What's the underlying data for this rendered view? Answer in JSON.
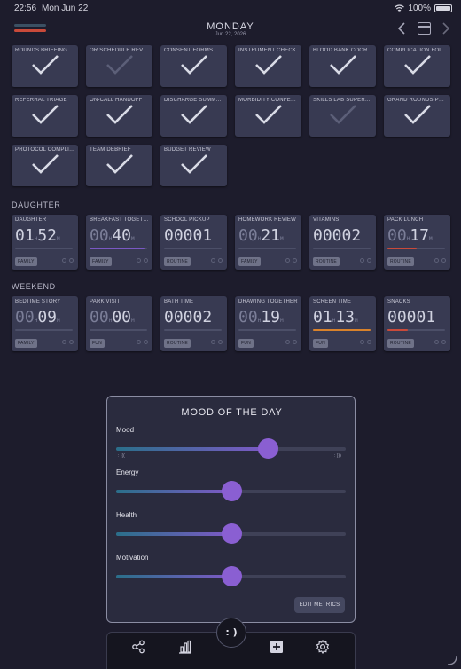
{
  "status": {
    "time": "22:56",
    "date": "Mon Jun 22",
    "battery": "100%"
  },
  "header": {
    "day": "MONDAY",
    "date": "Jun 22, 2026",
    "legend_colors": [
      "#3b5063",
      "#c94a3a"
    ]
  },
  "checklist": [
    {
      "label": "ROUNDS BRIEFING",
      "done": true
    },
    {
      "label": "OR SCHEDULE REVIEW",
      "done": false
    },
    {
      "label": "CONSENT FORMS",
      "done": true
    },
    {
      "label": "INSTRUMENT CHECK",
      "done": true
    },
    {
      "label": "BLOOD BANK COORDINATION",
      "done": true
    },
    {
      "label": "COMPLICATION FOLLOW-UP",
      "done": true
    },
    {
      "label": "REFERRAL TRIAGE",
      "done": true
    },
    {
      "label": "ON-CALL HANDOFF",
      "done": true
    },
    {
      "label": "DISCHARGE SUMMARIES",
      "done": true
    },
    {
      "label": "MORBIDITY CONFERENCE",
      "done": true
    },
    {
      "label": "SKILLS LAB SUPERVISION",
      "done": false
    },
    {
      "label": "GRAND ROUNDS PREP",
      "done": true
    },
    {
      "label": "PROTOCOL COMPLIANCE",
      "done": true
    },
    {
      "label": "TEAM DEBRIEF",
      "done": true
    },
    {
      "label": "BUDGET REVIEW",
      "done": true
    }
  ],
  "sections": {
    "daughter": "DAUGHTER",
    "weekend": "WEEKEND"
  },
  "daughter_tiles": [
    {
      "label": "DAUGHTER",
      "hours": "01",
      "minutes": "52",
      "badge": "FAMILY",
      "progress": 0.0,
      "bar_color": "#7a58c4"
    },
    {
      "label": "BREAKFAST TOGETHER",
      "hours": "00",
      "minutes": "40",
      "badge": "FAMILY",
      "progress": 0.95,
      "bar_color": "#7a58c4"
    },
    {
      "label": "SCHOOL PICKUP",
      "count": "00001",
      "badge": "ROUTINE",
      "progress": 0.0,
      "bar_color": "#7a58c4"
    },
    {
      "label": "HOMEWORK REVIEW",
      "hours": "00",
      "minutes": "21",
      "badge": "FAMILY",
      "progress": 0.0,
      "bar_color": "#7a58c4"
    },
    {
      "label": "VITAMINS",
      "count": "00002",
      "badge": "ROUTINE",
      "progress": 0.0,
      "bar_color": "#7a58c4"
    },
    {
      "label": "PACK LUNCH",
      "hours": "00",
      "minutes": "17",
      "badge": "ROUTINE",
      "progress": 0.5,
      "bar_color": "#c94a3a"
    }
  ],
  "weekend_tiles": [
    {
      "label": "BEDTIME STORY",
      "hours": "00",
      "minutes": "09",
      "badge": "FAMILY",
      "progress": 0.0,
      "bar_color": "#7a58c4"
    },
    {
      "label": "PARK VISIT",
      "hours": "00",
      "minutes": "00",
      "badge": "FUN",
      "progress": 0.0,
      "bar_color": "#7a58c4"
    },
    {
      "label": "BATH TIME",
      "count": "00002",
      "badge": "ROUTINE",
      "progress": 0.0,
      "bar_color": "#7a58c4"
    },
    {
      "label": "DRAWING TOGETHER",
      "hours": "00",
      "minutes": "19",
      "badge": "FUN",
      "progress": 0.0,
      "bar_color": "#7a58c4"
    },
    {
      "label": "SCREEN TIME",
      "hours": "01",
      "minutes": "13",
      "badge": "FUN",
      "progress": 1.0,
      "bar_color": "#d9822b"
    },
    {
      "label": "SNACKS",
      "count": "00001",
      "badge": "ROUTINE",
      "progress": 0.35,
      "bar_color": "#c94a3a"
    }
  ],
  "modal": {
    "title": "MOOD OF THE DAY",
    "metrics": [
      {
        "label": "Mood",
        "value": 0.66,
        "min_text": ": (((",
        "max_text": ": )))"
      },
      {
        "label": "Energy",
        "value": 0.5
      },
      {
        "label": "Health",
        "value": 0.5
      },
      {
        "label": "Motivation",
        "value": 0.5
      }
    ],
    "edit_button": "EDIT METRICS"
  },
  "toolbar": {
    "mood_button": ": )",
    "icons": [
      "share-icon",
      "chart-icon",
      "add-icon",
      "settings-icon"
    ]
  }
}
